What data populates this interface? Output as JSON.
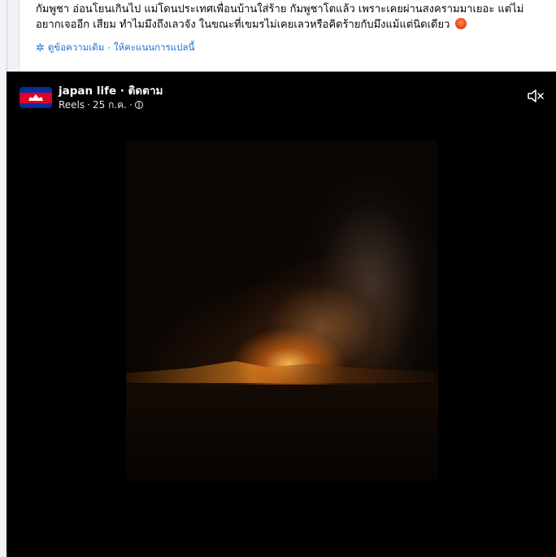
{
  "post": {
    "caption": "กัมพูชา อ่อนโยนเกินไป แม่โดนประเทศเพื่อนบ้านใส่ร้าย กัมพูชาโตแล้ว เพราะเคยผ่านสงครามมาเยอะ แต่ไม่อยากเจออีก เสียม ทำไมมึงถึงเลวจัง ในขณะที่เขมรไม่เคยเลวหรือคิดร้ายกับมึงแม้แต่นิดเดียว",
    "emoji_icon": "angry-face-emoji",
    "translate": {
      "icon": "gear-icon",
      "see_original": "ดูข้อความเดิม",
      "separator": "·",
      "rate_translation": "ให้คะแนนการแปลนี้"
    }
  },
  "video": {
    "page_name": "japan life",
    "follow_sep": " · ",
    "follow_label": "ติดตาม",
    "source": "Reels",
    "dot": "·",
    "date": "25 ก.ค.",
    "audience_icon": "globe-icon",
    "avatar_icon": "cambodia-flag-avatar",
    "mute_icon": "speaker-muted-icon"
  },
  "colors": {
    "link": "#216fdb",
    "video_bg": "#000000"
  }
}
